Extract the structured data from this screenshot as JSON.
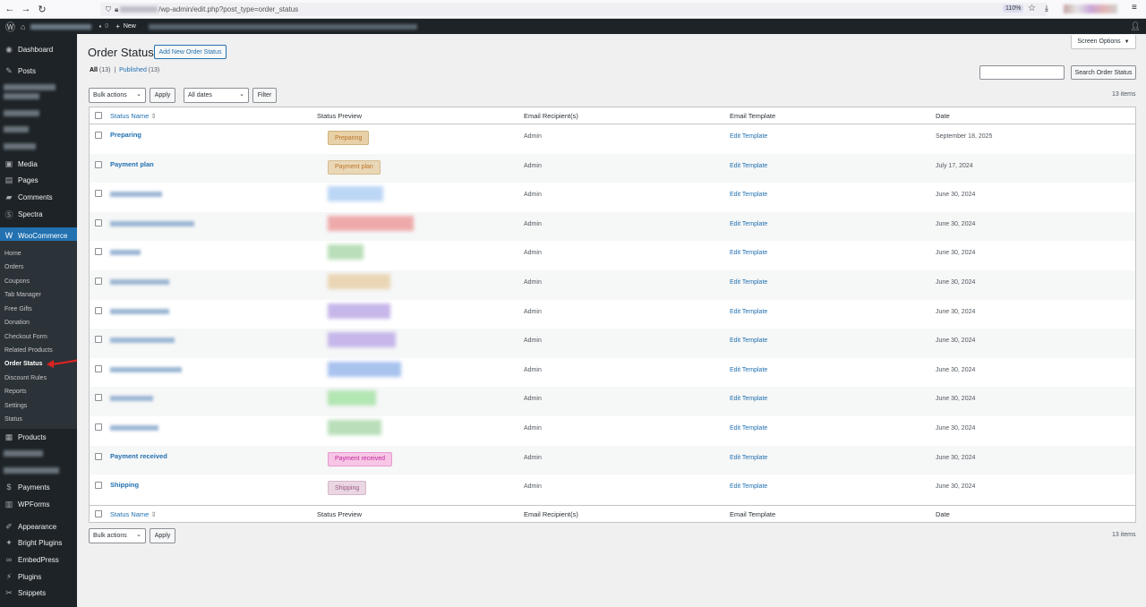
{
  "browser": {
    "url_suffix": "/wp-admin/edit.php?post_type=order_status",
    "zoom": "110%"
  },
  "adminbar": {
    "comments_count": "0",
    "new_label": "New"
  },
  "sidebar": {
    "dashboard": "Dashboard",
    "posts": "Posts",
    "media": "Media",
    "pages": "Pages",
    "comments": "Comments",
    "spectra": "Spectra",
    "woocommerce": "WooCommerce",
    "sub": [
      "Home",
      "Orders",
      "Coupons",
      "Tab Manager",
      "Free Gifts",
      "Donation",
      "Checkout Form",
      "Related Products",
      "Order Status",
      "Discount Rules",
      "Reports",
      "Settings",
      "Status"
    ],
    "products": "Products",
    "payments": "Payments",
    "wpforms": "WPForms",
    "appearance": "Appearance",
    "bright_plugins": "Bright Plugins",
    "embedpress": "EmbedPress",
    "plugins": "Plugins",
    "snippets": "Snippets"
  },
  "header": {
    "title": "Order Status",
    "add_new": "Add New Order Status",
    "screen_options": "Screen Options",
    "filter_all": "All",
    "filter_all_count": "(13)",
    "filter_sep": "|",
    "filter_published": "Published",
    "filter_published_count": "(13)",
    "search_button": "Search Order Status"
  },
  "toolbar": {
    "bulk_actions": "Bulk actions",
    "apply": "Apply",
    "all_dates": "All dates",
    "filter": "Filter",
    "items_count": "13 items"
  },
  "table": {
    "headers": [
      "Status Name",
      "Status Preview",
      "Email Recipient(s)",
      "Email Template",
      "Date"
    ],
    "rows": [
      {
        "name": "Preparing",
        "badge": "Preparing",
        "email": "Admin",
        "template": "Edit Template",
        "date": "September 18, 2025"
      },
      {
        "name": "Payment plan",
        "badge": "Payment plan",
        "email": "Admin",
        "template": "Edit Template",
        "date": "July 17, 2024"
      },
      {
        "name": "",
        "badge": "",
        "email": "Admin",
        "template": "Edit Template",
        "date": "June 30, 2024"
      },
      {
        "name": "",
        "badge": "",
        "email": "Admin",
        "template": "Edit Template",
        "date": "June 30, 2024"
      },
      {
        "name": "",
        "badge": "",
        "email": "Admin",
        "template": "Edit Template",
        "date": "June 30, 2024"
      },
      {
        "name": "",
        "badge": "",
        "email": "Admin",
        "template": "Edit Template",
        "date": "June 30, 2024"
      },
      {
        "name": "",
        "badge": "",
        "email": "Admin",
        "template": "Edit Template",
        "date": "June 30, 2024"
      },
      {
        "name": "",
        "badge": "",
        "email": "Admin",
        "template": "Edit Template",
        "date": "June 30, 2024"
      },
      {
        "name": "",
        "badge": "",
        "email": "Admin",
        "template": "Edit Template",
        "date": "June 30, 2024"
      },
      {
        "name": "",
        "badge": "",
        "email": "Admin",
        "template": "Edit Template",
        "date": "June 30, 2024"
      },
      {
        "name": "",
        "badge": "",
        "email": "Admin",
        "template": "Edit Template",
        "date": "June 30, 2024"
      },
      {
        "name": "Payment received",
        "badge": "Payment received",
        "email": "Admin",
        "template": "Edit Template",
        "date": "June 30, 2024"
      },
      {
        "name": "Shipping",
        "badge": "Shipping",
        "email": "Admin",
        "template": "Edit Template",
        "date": "June 30, 2024"
      }
    ]
  },
  "colors": {
    "accent": "#2271b1",
    "sidebar_bg": "#1d2327",
    "badge_preparing_bg": "#e8d1a8",
    "badge_preparing_fg": "#b8742b",
    "badge_payment_plan_bg": "#ead7b6",
    "badge_payment_received_bg": "#f7c6e6",
    "badge_payment_received_fg": "#c2259a",
    "badge_shipping_bg": "#ead7e3"
  }
}
